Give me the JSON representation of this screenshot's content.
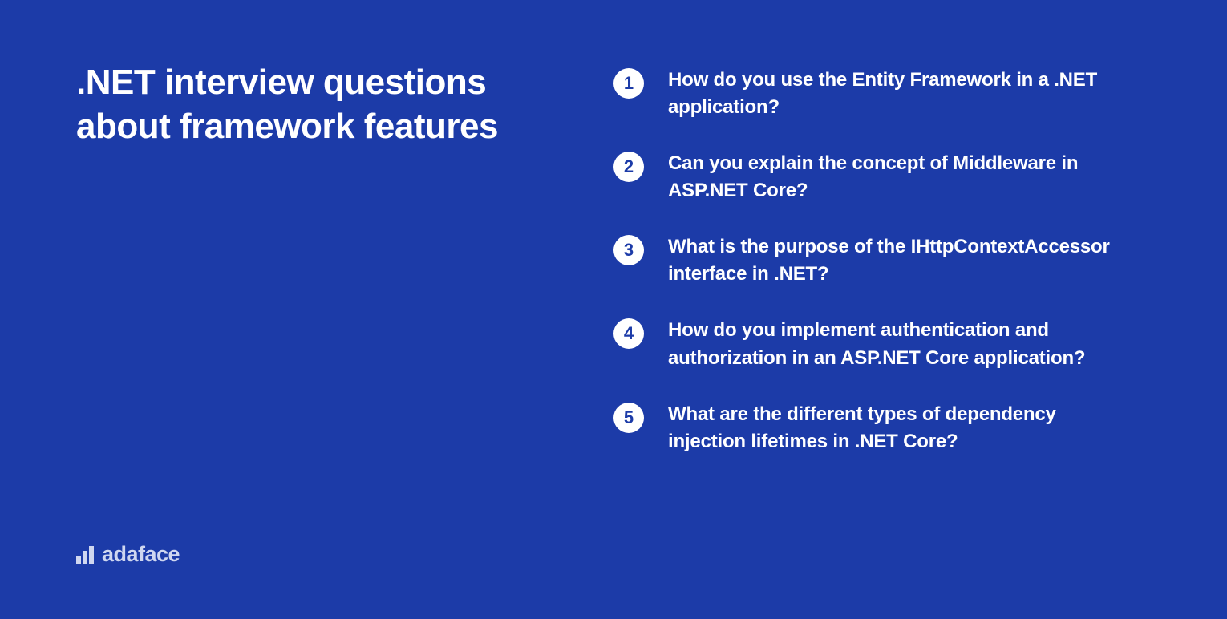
{
  "title": ".NET interview questions about framework features",
  "logo_text": "adaface",
  "items": [
    {
      "num": "1",
      "text": "How do you use the Entity Framework in a .NET application?"
    },
    {
      "num": "2",
      "text": "Can you explain the concept of Middleware in ASP.NET Core?"
    },
    {
      "num": "3",
      "text": "What is the purpose of the IHttpContextAccessor interface in .NET?"
    },
    {
      "num": "4",
      "text": "How do you implement authentication and authorization in an ASP.NET Core application?"
    },
    {
      "num": "5",
      "text": "What are the different types of dependency injection lifetimes in .NET Core?"
    }
  ]
}
